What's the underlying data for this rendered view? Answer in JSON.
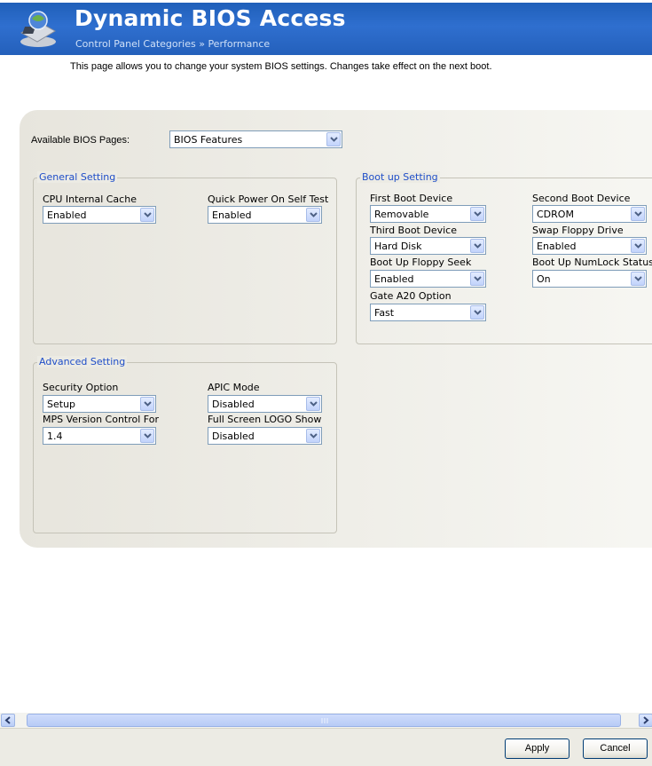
{
  "header": {
    "title": "Dynamic BIOS Access",
    "subtitle": "Control Panel Categories  »  Performance",
    "icon": "bios-chip-icon"
  },
  "description": "This page allows you to change your system BIOS settings.  Changes take effect on the next boot.",
  "available_pages": {
    "label": "Available BIOS Pages:",
    "value": "BIOS Features"
  },
  "general": {
    "title": "General Setting",
    "cpu_cache": {
      "label": "CPU Internal Cache",
      "value": "Enabled"
    },
    "quick_power": {
      "label": "Quick Power On Self Test",
      "value": "Enabled"
    }
  },
  "boot": {
    "title": "Boot up Setting",
    "first": {
      "label": "First Boot Device",
      "value": "Removable"
    },
    "second": {
      "label": "Second Boot Device",
      "value": "CDROM"
    },
    "third": {
      "label": "Third Boot Device",
      "value": "Hard Disk"
    },
    "swap": {
      "label": "Swap Floppy Drive",
      "value": "Enabled"
    },
    "floppy_seek": {
      "label": "Boot Up Floppy Seek",
      "value": "Enabled"
    },
    "numlock": {
      "label": "Boot Up NumLock Status",
      "value": "On"
    },
    "gate_a20": {
      "label": "Gate A20 Option",
      "value": "Fast"
    }
  },
  "advanced": {
    "title": "Advanced Setting",
    "security": {
      "label": "Security Option",
      "value": "Setup"
    },
    "apic": {
      "label": "APIC Mode",
      "value": "Disabled"
    },
    "mps": {
      "label": "MPS Version Control For",
      "value": "1.4"
    },
    "logo": {
      "label": "Full Screen LOGO Show",
      "value": "Disabled"
    }
  },
  "buttons": {
    "apply": "Apply",
    "cancel": "Cancel"
  },
  "colors": {
    "header": "#2f6fcf",
    "group_title": "#1f4ec8"
  }
}
